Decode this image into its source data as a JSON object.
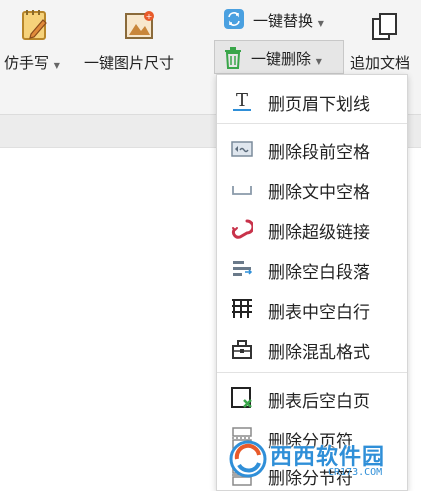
{
  "ribbon": {
    "imitate_handwriting": "仿手写",
    "image_size": "一键图片尺寸",
    "replace": "一键替换",
    "delete": "一键删除",
    "append_doc": "追加文档"
  },
  "menu": {
    "items": [
      {
        "label": "删页眉下划线",
        "icon": "text-underline-icon"
      },
      {
        "label": "删除段前空格",
        "icon": "paragraph-space-icon"
      },
      {
        "label": "删除文中空格",
        "icon": "inline-space-icon"
      },
      {
        "label": "删除超级链接",
        "icon": "hyperlink-icon"
      },
      {
        "label": "删除空白段落",
        "icon": "blank-paragraph-icon"
      },
      {
        "label": "删表中空白行",
        "icon": "table-grid-icon"
      },
      {
        "label": "删除混乱格式",
        "icon": "format-eraser-icon"
      },
      {
        "label": "删表后空白页",
        "icon": "blank-page-icon"
      },
      {
        "label": "删除分页符",
        "icon": "page-break-icon"
      },
      {
        "label": "删除分节符",
        "icon": "section-break-icon"
      }
    ]
  },
  "watermark": {
    "brand": "西西软件园",
    "url": "CR173.COM"
  },
  "colors": {
    "accent": "#2f8fd8",
    "orange": "#d58a2a",
    "red": "#c8324a",
    "green": "#3aa64a"
  }
}
